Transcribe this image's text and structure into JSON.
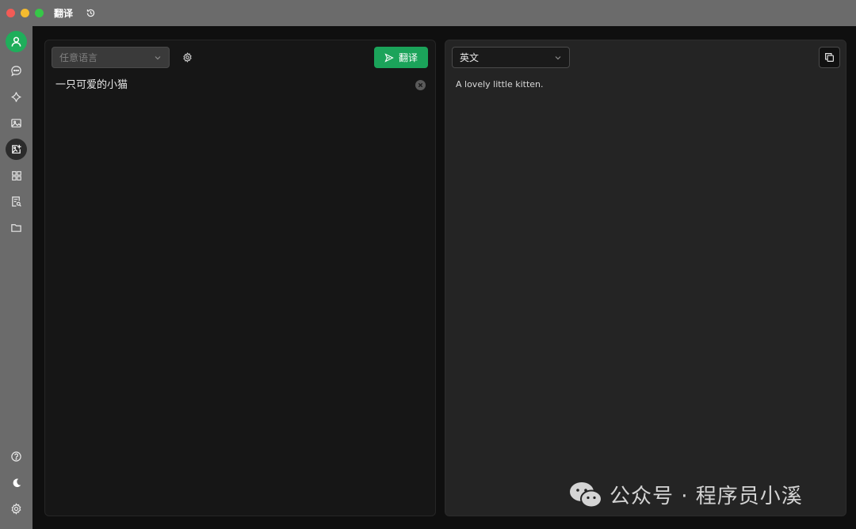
{
  "window": {
    "title": "翻译"
  },
  "icons": {
    "history": "history-icon",
    "sidebar_top": [
      "user-icon",
      "chat-icon",
      "sparkle-icon",
      "image-icon",
      "image-edit-icon",
      "grid-icon",
      "document-search-icon",
      "folder-icon"
    ],
    "sidebar_bottom": [
      "help-icon",
      "moon-icon",
      "gear-icon"
    ]
  },
  "colors": {
    "accent": "#1ba35a",
    "avatar_bg": "#1fae5b"
  },
  "source": {
    "language_placeholder": "任意语言",
    "text": "一只可爱的小猫",
    "translate_label": "翻译"
  },
  "target": {
    "language": "英文",
    "result": "A lovely little kitten."
  },
  "watermark": {
    "text": "公众号 · 程序员小溪"
  }
}
